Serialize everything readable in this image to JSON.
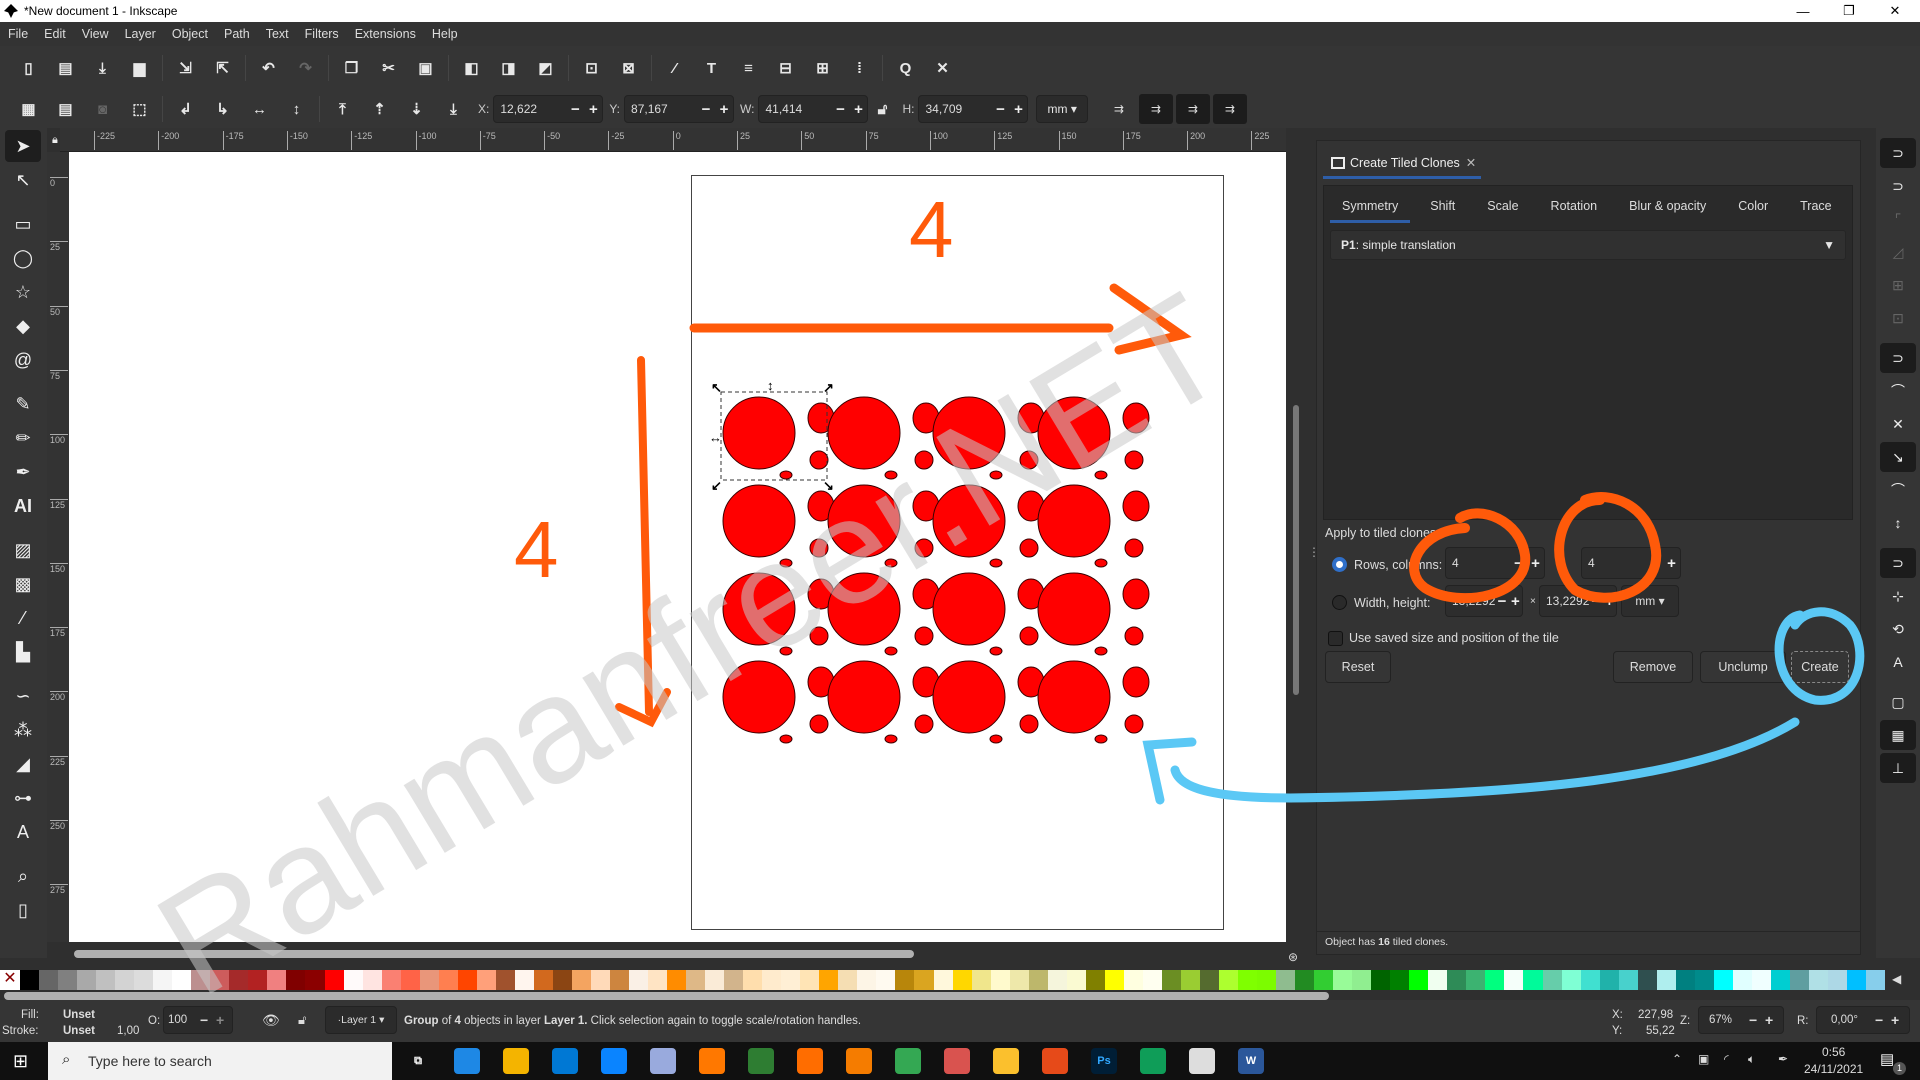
{
  "window": {
    "title": "*New document 1 - Inkscape",
    "minimize": "—",
    "maximize": "❐",
    "close": "✕"
  },
  "menu": [
    "File",
    "Edit",
    "View",
    "Layer",
    "Object",
    "Path",
    "Text",
    "Filters",
    "Extensions",
    "Help"
  ],
  "toolbar_commands": {
    "icons": [
      "new-document",
      "open",
      "save",
      "print",
      "import",
      "export",
      "undo",
      "redo",
      "copy",
      "cut",
      "paste",
      "duplicate",
      "clone",
      "unlink-clone",
      "group",
      "ungroup",
      "xml-editor",
      "text-font",
      "layers",
      "objects",
      "symbols",
      "align-distribute",
      "document-properties",
      "preferences"
    ]
  },
  "tool_controls": {
    "icons": [
      "select-all",
      "select-all-layers",
      "deselect",
      "touch-select",
      "rotate-ccw",
      "rotate-cw",
      "flip-horizontal",
      "flip-vertical",
      "raise-to-top",
      "raise",
      "lower",
      "lower-to-bottom"
    ],
    "x": {
      "label": "X:",
      "value": "12,622"
    },
    "y": {
      "label": "Y:",
      "value": "87,167"
    },
    "w": {
      "label": "W:",
      "value": "41,414"
    },
    "h": {
      "label": "H:",
      "value": "34,709"
    },
    "unit": "mm",
    "minus": "−",
    "plus": "+"
  },
  "ruler": {
    "h_ticks": [
      "-225",
      "-200",
      "-175",
      "-150",
      "-125",
      "-100",
      "-75",
      "-50",
      "-25",
      "0",
      "25",
      "50",
      "75",
      "100",
      "125",
      "150",
      "175",
      "200",
      "225"
    ],
    "v_ticks": [
      "0",
      "25",
      "50",
      "75",
      "100",
      "125",
      "150",
      "175",
      "200",
      "225",
      "250",
      "275"
    ]
  },
  "canvas": {
    "tile_grid": {
      "rows": 4,
      "columns": 4
    },
    "circle_fill": "#ff0000",
    "annotations": {
      "top_count": "4",
      "left_count": "4",
      "annotation_color": "#ff5a0a",
      "highlight_color": "#5bc8f5"
    },
    "watermark": "Rahmanfreer.NET"
  },
  "dialog": {
    "title": "Create Tiled Clones",
    "tabs": [
      {
        "label": "Symmetry",
        "active": true
      },
      {
        "label": "Shift"
      },
      {
        "label": "Scale"
      },
      {
        "label": "Rotation"
      },
      {
        "label": "Blur & opacity"
      },
      {
        "label": "Color"
      },
      {
        "label": "Trace"
      }
    ],
    "symmetry": {
      "code": "P1",
      "label": ": simple translation"
    },
    "apply_label": "Apply to tiled clones:",
    "rows_cols": {
      "label": "Rows, columns:",
      "rows": "4",
      "cols": "4",
      "selected": true
    },
    "width_height": {
      "label": "Width, height:",
      "width": "13,2292",
      "height": "13,2292",
      "unit": "mm",
      "selected": false
    },
    "times": "×",
    "use_saved": {
      "label": "Use saved size and position of the tile",
      "checked": false
    },
    "buttons": {
      "reset": "Reset",
      "remove": "Remove",
      "unclump": "Unclump",
      "create": "Create"
    },
    "status": {
      "prefix": "Object has ",
      "count": "16",
      "suffix": " tiled clones."
    }
  },
  "palette": [
    "#ffffff",
    "#000000",
    "#666666",
    "#808080",
    "#a9a9a9",
    "#c0c0c0",
    "#d3d3d3",
    "#dcdcdc",
    "#f5f5f5",
    "#ffffff",
    "#bc8f8f",
    "#cd5c5c",
    "#a52a2a",
    "#b22222",
    "#f08080",
    "#800000",
    "#8b0000",
    "#ff0000",
    "#fffafa",
    "#ffe4e1",
    "#fa8072",
    "#ff6347",
    "#e9967a",
    "#ff7f50",
    "#ff4500",
    "#ffa07a",
    "#a0522d",
    "#fff5ee",
    "#d2691e",
    "#8b4513",
    "#f4a460",
    "#ffdab9",
    "#cd853f",
    "#faf0e6",
    "#ffe4c4",
    "#ff8c00",
    "#deb887",
    "#faebd7",
    "#d2b48c",
    "#ffdead",
    "#ffebcd",
    "#ffefd5",
    "#ffe4b5",
    "#ffa500",
    "#f5deb3",
    "#fdf5e6",
    "#fffaf0",
    "#b8860b",
    "#daa520",
    "#fff8dc",
    "#ffd700",
    "#f0e68c",
    "#fffacd",
    "#eee8aa",
    "#bdb76b",
    "#f5f5dc",
    "#fafad2",
    "#808000",
    "#ffff00",
    "#ffffe0",
    "#fffff0",
    "#6b8e23",
    "#9acd32",
    "#556b2f",
    "#adff2f",
    "#7fff00",
    "#7cfc00",
    "#8fbc8f",
    "#228b22",
    "#32cd32",
    "#98fb98",
    "#90ee90",
    "#006400",
    "#008000",
    "#00ff00",
    "#f0fff0",
    "#2e8b57",
    "#3cb371",
    "#00ff7f",
    "#f5fffa",
    "#00fa9a",
    "#66cdaa",
    "#7fffd4",
    "#40e0d0",
    "#20b2aa",
    "#48d1cc",
    "#2f4f4f",
    "#afeeee",
    "#008080",
    "#008b8b",
    "#00ffff",
    "#e0ffff",
    "#f0ffff",
    "#00ced1",
    "#5f9ea0",
    "#b0e0e6",
    "#add8e6",
    "#00bfff",
    "#87ceeb"
  ],
  "status": {
    "fill_label": "Fill:",
    "fill_value": "Unset",
    "stroke_label": "Stroke:",
    "stroke_value": "Unset",
    "stroke_width": "1,00",
    "opacity_label": "O:",
    "opacity_value": "100",
    "layer": "·Layer 1",
    "message_pre": "Group",
    "message_mid1": " of ",
    "message_count": "4",
    "message_mid2": " objects in layer ",
    "message_layer": "Layer 1.",
    "message_post": " Click selection again to toggle scale/rotation handles.",
    "cursor_x_label": "X:",
    "cursor_x": "227,98",
    "cursor_y_label": "Y:",
    "cursor_y": "55,22",
    "zoom_label": "Z:",
    "zoom": "67%",
    "rotate_label": "R:",
    "rotate": "0,00°"
  },
  "taskbar": {
    "search_placeholder": "Type here to search",
    "apps": [
      "task-view",
      "edge",
      "file-explorer",
      "microsoft-store",
      "mail",
      "notepad",
      "vlc",
      "video-editor",
      "firefox",
      "media-player",
      "chrome",
      "snipping-tool",
      "sticky-notes",
      "chrome-dev",
      "photoshop",
      "edge-beta",
      "inkscape",
      "word"
    ],
    "time": "0:56",
    "date": "24/11/2021",
    "notifications": "1"
  }
}
